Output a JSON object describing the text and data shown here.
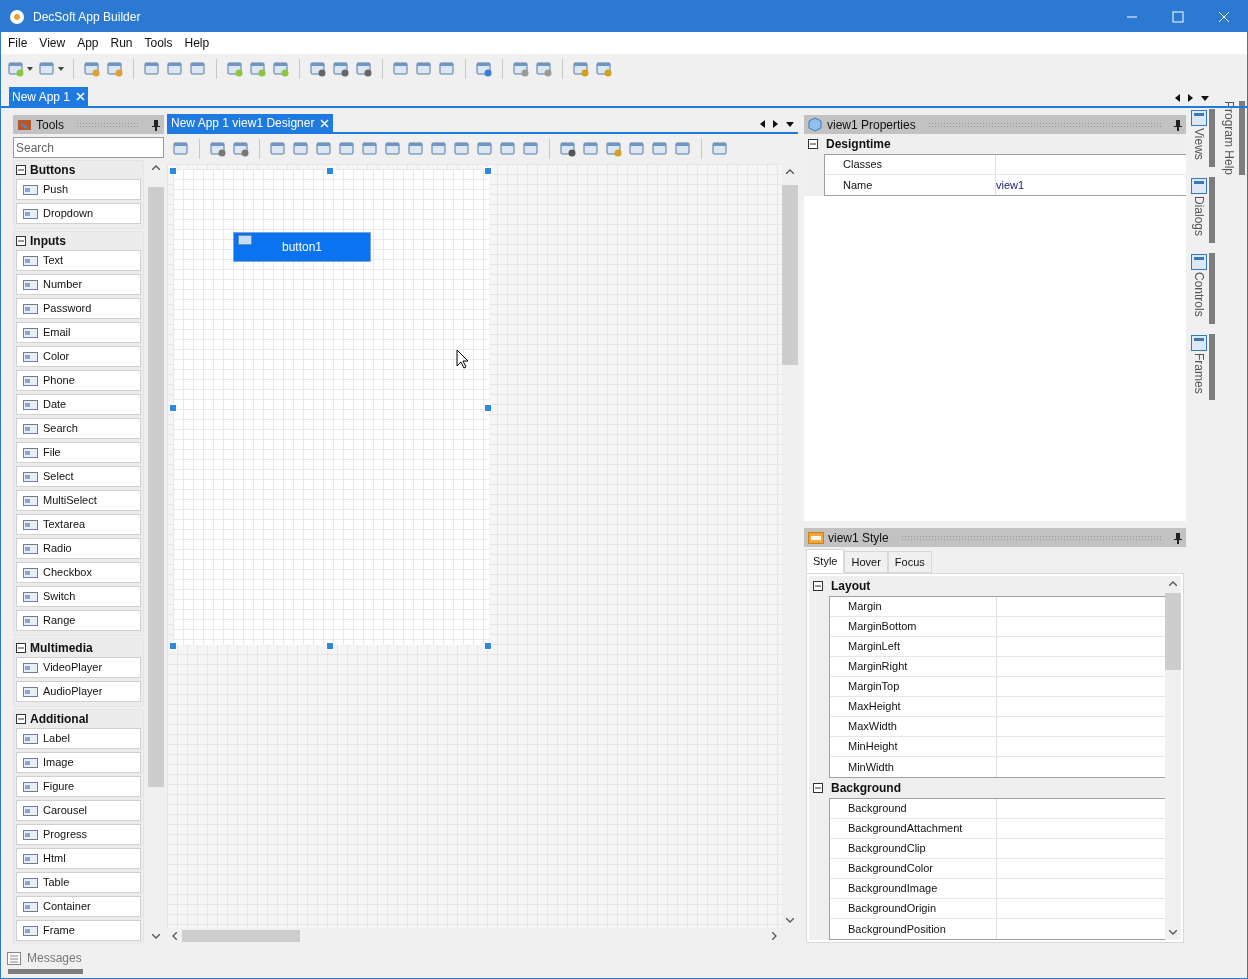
{
  "window": {
    "title": "DecSoft App Builder"
  },
  "menu": [
    "File",
    "View",
    "App",
    "Run",
    "Tools",
    "Help"
  ],
  "document_tabs": [
    {
      "label": "New App 1",
      "selected": true
    }
  ],
  "tools_panel": {
    "title": "Tools",
    "search": {
      "placeholder": "Search"
    },
    "groups": [
      {
        "title": "Buttons",
        "expanded": true,
        "items": [
          "Push",
          "Dropdown"
        ]
      },
      {
        "title": "Inputs",
        "expanded": true,
        "items": [
          "Text",
          "Number",
          "Password",
          "Email",
          "Color",
          "Phone",
          "Date",
          "Search",
          "File",
          "Select",
          "MultiSelect",
          "Textarea",
          "Radio",
          "Checkbox",
          "Switch",
          "Range"
        ]
      },
      {
        "title": "Multimedia",
        "expanded": true,
        "items": [
          "VideoPlayer",
          "AudioPlayer"
        ]
      },
      {
        "title": "Additional",
        "expanded": true,
        "items": [
          "Label",
          "Image",
          "Figure",
          "Carousel",
          "Progress",
          "Html",
          "Table",
          "Container",
          "Frame"
        ]
      }
    ]
  },
  "designer": {
    "tab": {
      "label": "New App 1 view1 Designer",
      "selected": true
    },
    "button": {
      "label": "button1"
    }
  },
  "properties_panel": {
    "title": "view1 Properties",
    "groups": [
      {
        "title": "Designtime",
        "expanded": true,
        "rows": [
          {
            "name": "Classes"
          },
          {
            "name": "Name",
            "value": "view1"
          }
        ]
      }
    ]
  },
  "style_panel": {
    "title": "view1 Style",
    "tabs": [
      {
        "label": "Style",
        "selected": true
      },
      {
        "label": "Hover",
        "selected": false
      },
      {
        "label": "Focus",
        "selected": false
      }
    ],
    "groups": [
      {
        "title": "Layout",
        "expanded": true,
        "rows": [
          {
            "name": "Margin"
          },
          {
            "name": "MarginBottom"
          },
          {
            "name": "MarginLeft"
          },
          {
            "name": "MarginRight"
          },
          {
            "name": "MarginTop"
          },
          {
            "name": "MaxHeight"
          },
          {
            "name": "MaxWidth"
          },
          {
            "name": "MinHeight"
          },
          {
            "name": "MinWidth"
          }
        ]
      },
      {
        "title": "Background",
        "expanded": true,
        "rows": [
          {
            "name": "Background"
          },
          {
            "name": "BackgroundAttachment"
          },
          {
            "name": "BackgroundClip"
          },
          {
            "name": "BackgroundColor"
          },
          {
            "name": "BackgroundImage"
          },
          {
            "name": "BackgroundOrigin"
          },
          {
            "name": "BackgroundPosition"
          }
        ]
      }
    ]
  },
  "side_tabs": [
    {
      "label": "Views"
    },
    {
      "label": "Dialogs"
    },
    {
      "label": "Controls"
    },
    {
      "label": "Frames"
    }
  ],
  "help_tab": {
    "label": "Program Help"
  },
  "status_bar": {
    "label": "Messages"
  }
}
